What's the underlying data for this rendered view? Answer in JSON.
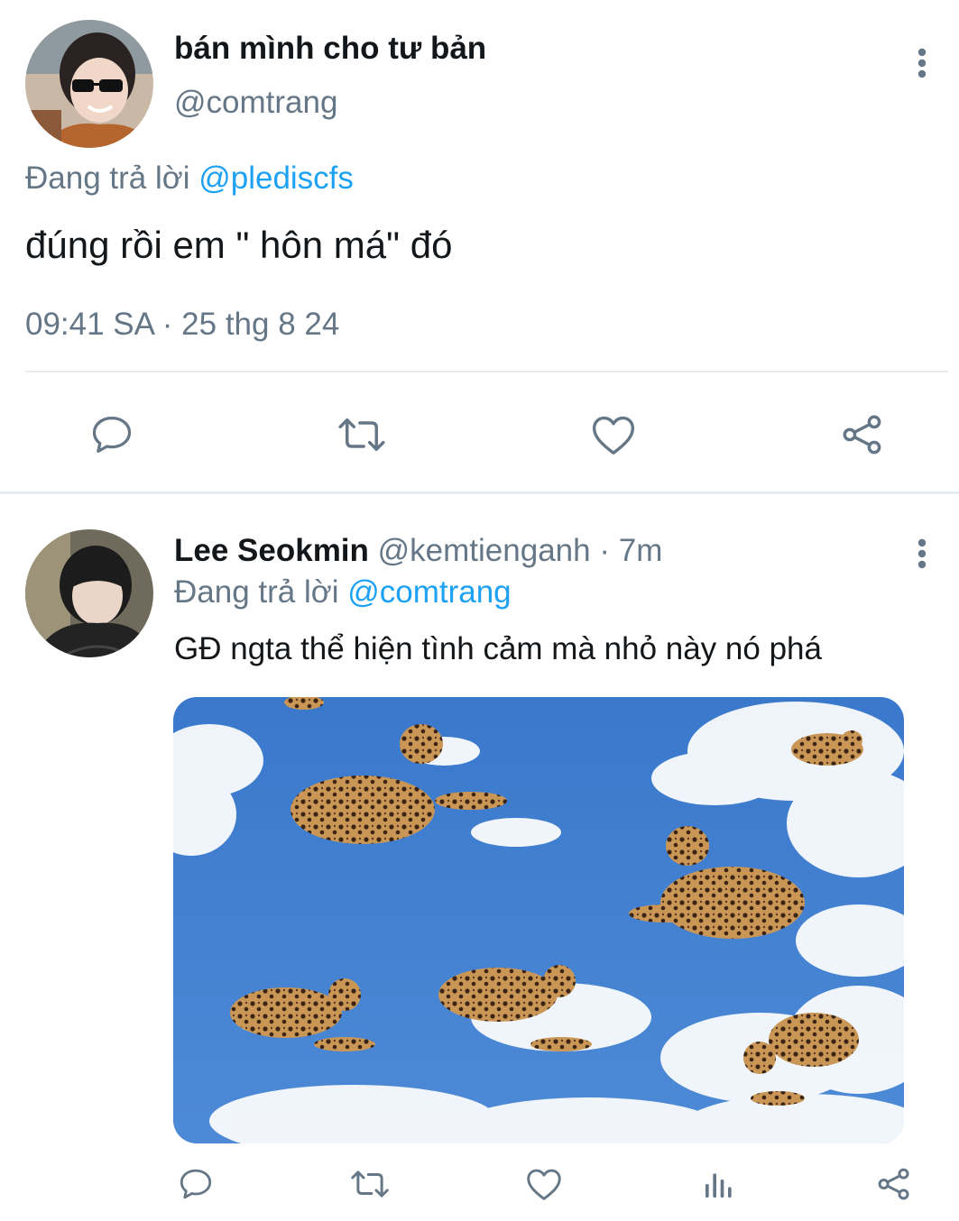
{
  "tweet_main": {
    "display_name": "bán mình cho tư bản",
    "handle": "@comtrang",
    "reply_prefix": "Đang trả lời",
    "reply_to": "@plediscfs",
    "text": "đúng rồi em \" hôn má\" đó",
    "timestamp": "09:41 SA · 25 thg 8 24",
    "actions": [
      "reply-icon",
      "retweet-icon",
      "like-icon",
      "share-icon"
    ]
  },
  "tweet_reply": {
    "display_name": "Lee Seokmin",
    "handle": "@kemtienganh",
    "time_ago": "· 7m",
    "reply_prefix": "Đang trả lời",
    "reply_to": "@comtrang",
    "text": "GĐ ngta thể hiện tình cảm mà nhỏ này nó phá",
    "media": "image: leopards floating in a blue sky with clouds",
    "actions": [
      "reply-icon",
      "retweet-icon",
      "like-icon",
      "analytics-icon",
      "share-icon"
    ]
  },
  "colors": {
    "text": "#14171a",
    "secondary": "#657786",
    "link": "#1da1f2",
    "icon": "#657786",
    "divider": "#e6ecf0",
    "sky": "#3f7fd1"
  }
}
